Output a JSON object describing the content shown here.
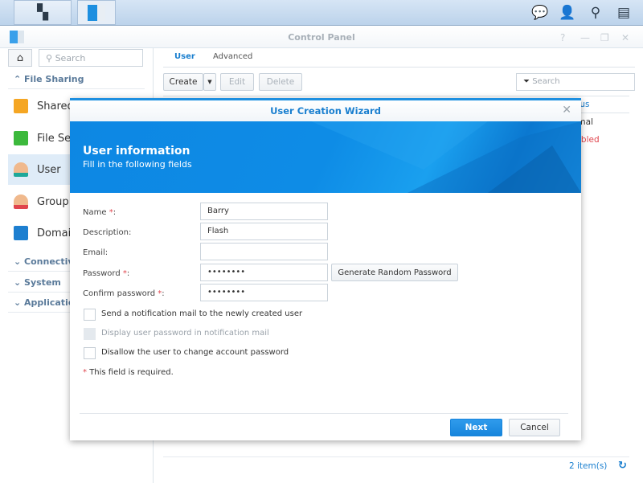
{
  "taskbar": {
    "icons": [
      "main-menu-icon",
      "control-panel-icon",
      "notifications-icon",
      "user-icon",
      "search-icon",
      "widgets-icon"
    ]
  },
  "window": {
    "title": "Control Panel"
  },
  "sidebar": {
    "search_placeholder": "Search",
    "sections": [
      {
        "label": "File Sharing",
        "expanded": true
      },
      {
        "label": "Connectivity"
      },
      {
        "label": "System"
      },
      {
        "label": "Applications"
      }
    ],
    "items": [
      {
        "label": "Shared Folder"
      },
      {
        "label": "File Services"
      },
      {
        "label": "User",
        "selected": true
      },
      {
        "label": "Group"
      },
      {
        "label": "Domain/LDAP"
      }
    ]
  },
  "main": {
    "tabs": [
      {
        "label": "User",
        "active": true
      },
      {
        "label": "Advanced"
      }
    ],
    "toolbar": {
      "create": "Create",
      "edit": "Edit",
      "delete": "Delete",
      "search_placeholder": "Search"
    },
    "table": {
      "status_header": "Status",
      "rows": [
        {
          "status": "Normal"
        },
        {
          "status": "Disabled"
        }
      ]
    },
    "footer": {
      "count": "2 item(s)"
    }
  },
  "dialog": {
    "title": "User Creation Wizard",
    "heading": "User information",
    "subheading": "Fill in the following fields",
    "fields": [
      {
        "label": "Name",
        "required": true,
        "value": "Barry"
      },
      {
        "label": "Description",
        "required": false,
        "value": "Flash"
      },
      {
        "label": "Email",
        "required": false,
        "value": ""
      },
      {
        "label": "Password",
        "required": true,
        "value": "••••••••"
      },
      {
        "label": "Confirm password",
        "required": true,
        "value": "••••••••"
      }
    ],
    "generate_password": "Generate Random Password",
    "checkboxes": [
      {
        "label": "Send a notification mail to the newly created user",
        "checked": false,
        "disabled": false
      },
      {
        "label": "Display user password in notification mail",
        "checked": false,
        "disabled": true
      },
      {
        "label": "Disallow the user to change account password",
        "checked": false,
        "disabled": false
      }
    ],
    "required_note": "This field is required.",
    "next": "Next",
    "cancel": "Cancel"
  },
  "colors": {
    "accent": "#1d8fe0",
    "disabled_status": "#e0454d"
  }
}
